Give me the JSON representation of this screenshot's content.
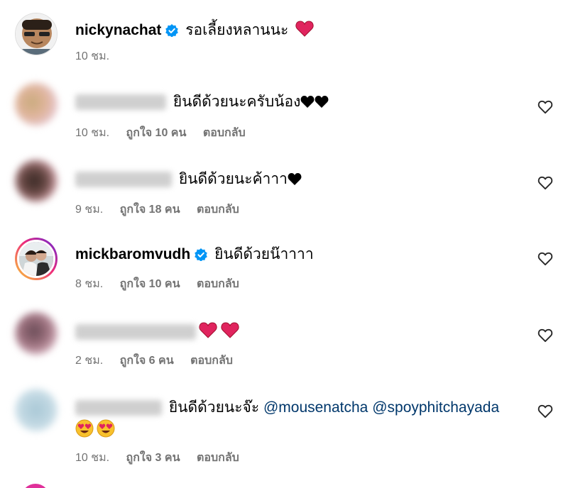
{
  "colors": {
    "text": "#000000",
    "meta": "#737373",
    "verified": "#0095f6",
    "mention": "#00376b",
    "heart_red": "#e0245e"
  },
  "comments": [
    {
      "username": "nickynachat",
      "verified": true,
      "text": "รอเลี้ยงหลานนะ",
      "emoji": "red-heart",
      "time": "10 ชม."
    },
    {
      "username_hidden": true,
      "text": "ยินดีด้วยนะครับน้อง",
      "emoji": "black-heart x2",
      "time": "10 ชม.",
      "likes": "ถูกใจ 10 คน",
      "reply": "ตอบกลับ"
    },
    {
      "username_hidden": true,
      "text": "ยินดีด้วยนะค้าาา",
      "emoji": "black-heart",
      "time": "9 ชม.",
      "likes": "ถูกใจ 18 คน",
      "reply": "ตอบกลับ"
    },
    {
      "username": "mickbaromvudh",
      "verified": true,
      "text": "ยินดีด้วยน๊าาาา",
      "time": "8 ชม.",
      "likes": "ถูกใจ 10 คน",
      "reply": "ตอบกลับ"
    },
    {
      "username_hidden": true,
      "text": "",
      "emoji": "red-heart x2",
      "time": "2 ชม.",
      "likes": "ถูกใจ 6 คน",
      "reply": "ตอบกลับ"
    },
    {
      "username_hidden": true,
      "text": "ยินดีด้วยนะจ๊ะ",
      "mentions": [
        "@mousenatcha",
        "@spoyphitchayada"
      ],
      "emoji": "heart-eyes x2",
      "time": "10 ชม.",
      "likes": "ถูกใจ 3 คน",
      "reply": "ตอบกลับ"
    }
  ]
}
